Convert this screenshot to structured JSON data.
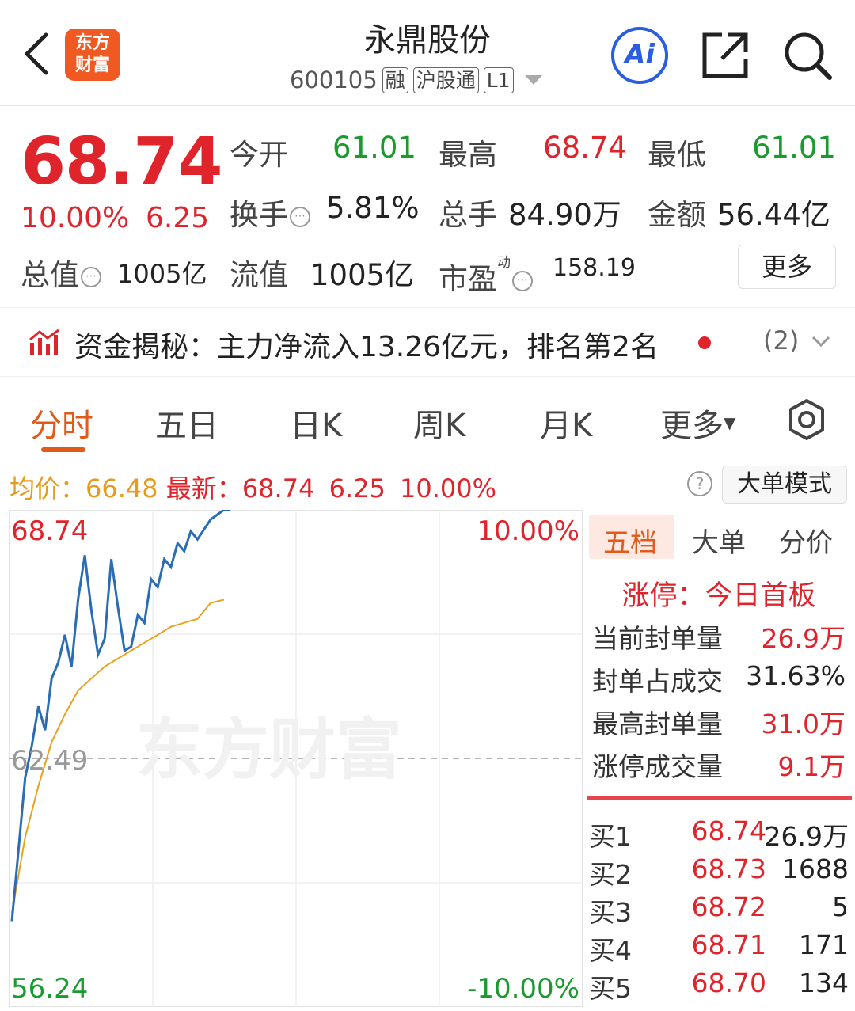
{
  "header": {
    "back_icon": "chevron-left-icon",
    "logo_line1": "东方",
    "logo_line2": "财富",
    "stock_name": "永鼎股份",
    "stock_code": "600105",
    "tags": [
      "融",
      "沪股通",
      "L1"
    ],
    "ai_label": "Ai",
    "share_icon": "share-icon",
    "search_icon": "search-icon"
  },
  "quote": {
    "price": "68.74",
    "change_pct": "10.00%",
    "change": "6.25",
    "open_label": "今开",
    "open_value": "61.01",
    "high_label": "最高",
    "high_value": "68.74",
    "low_label": "最低",
    "low_value": "61.01",
    "turnover_label": "换手",
    "turnover_value": "5.81%",
    "volume_label": "总手",
    "volume_value": "84.90万",
    "amount_label": "金额",
    "amount_value": "56.44亿",
    "mktcap_label": "总值",
    "mktcap_value": "1005亿",
    "float_label": "流值",
    "float_value": "1005亿",
    "pe_label": "市盈",
    "pe_sup": "动",
    "pe_value": "158.19",
    "more_label": "更多"
  },
  "fund_flow": {
    "text": "资金揭秘：主力净流入13.26亿元，排名第2名",
    "count": "(2)"
  },
  "tabs": {
    "items": [
      "分时",
      "五日",
      "日K",
      "周K",
      "月K",
      "更多"
    ],
    "active": "分时"
  },
  "summary": {
    "avg_label": "均价：",
    "avg_value": "66.48",
    "latest_label": "最新：",
    "latest_value": "68.74",
    "latest_change": "6.25",
    "latest_pct": "10.00%",
    "mode_button": "大单模式"
  },
  "chart": {
    "watermark": "东方财富",
    "y_top": "68.74",
    "y_mid": "62.49",
    "y_bottom": "56.24",
    "pct_top": "10.00%",
    "pct_bottom": "-10.00%",
    "colors": {
      "price": "#2a6db5",
      "avg": "#e8a21d",
      "up": "#e0242b",
      "down": "#1a9a2f"
    }
  },
  "chart_data": {
    "type": "line",
    "ylim": [
      56.24,
      68.74
    ],
    "xlim": [
      0,
      240
    ],
    "series": [
      {
        "values": [
          [
            0,
            58.4
          ],
          [
            0.5,
            60.2
          ],
          [
            1,
            62.0
          ],
          [
            1.5,
            62.8
          ],
          [
            2,
            63.8
          ],
          [
            2.5,
            63.2
          ],
          [
            3,
            64.5
          ],
          [
            3.5,
            64.9
          ],
          [
            4,
            65.6
          ],
          [
            4.5,
            64.8
          ],
          [
            5,
            66.5
          ],
          [
            5.5,
            67.6
          ],
          [
            6,
            66.2
          ],
          [
            6.5,
            65.1
          ],
          [
            7,
            65.5
          ],
          [
            7.5,
            67.5
          ],
          [
            8,
            66.3
          ],
          [
            8.5,
            65.2
          ],
          [
            9,
            65.3
          ],
          [
            9.5,
            66.1
          ],
          [
            10,
            65.9
          ],
          [
            10.5,
            67.0
          ],
          [
            11,
            66.8
          ],
          [
            11.5,
            67.5
          ],
          [
            12,
            67.3
          ],
          [
            12.5,
            67.9
          ],
          [
            13,
            67.7
          ],
          [
            13.5,
            68.2
          ],
          [
            14,
            68.0
          ],
          [
            15,
            68.5
          ],
          [
            16,
            68.74
          ],
          [
            16.5,
            68.74
          ]
        ]
      },
      {
        "values": [
          [
            0,
            58.6
          ],
          [
            1,
            60.5
          ],
          [
            2,
            61.8
          ],
          [
            3,
            62.9
          ],
          [
            4,
            63.6
          ],
          [
            5,
            64.2
          ],
          [
            6,
            64.5
          ],
          [
            7,
            64.8
          ],
          [
            8,
            65.0
          ],
          [
            9,
            65.2
          ],
          [
            10,
            65.4
          ],
          [
            11,
            65.6
          ],
          [
            12,
            65.8
          ],
          [
            13,
            65.9
          ],
          [
            14,
            66.0
          ],
          [
            15,
            66.4
          ],
          [
            16,
            66.48
          ]
        ]
      }
    ]
  },
  "order_book": {
    "tabs": [
      "五档",
      "大单",
      "分价"
    ],
    "active_tab": "五档",
    "limit_title": "涨停：今日首板",
    "stats": [
      {
        "label": "当前封单量",
        "value": "26.9万"
      },
      {
        "label": "封单占成交",
        "value": "31.63%"
      },
      {
        "label": "最高封单量",
        "value": "31.0万"
      },
      {
        "label": "涨停成交量",
        "value": "9.1万"
      }
    ],
    "bids": [
      {
        "label": "买1",
        "price": "68.74",
        "qty": "26.9万"
      },
      {
        "label": "买2",
        "price": "68.73",
        "qty": "1688"
      },
      {
        "label": "买3",
        "price": "68.72",
        "qty": "5"
      },
      {
        "label": "买4",
        "price": "68.71",
        "qty": "171"
      },
      {
        "label": "买5",
        "price": "68.70",
        "qty": "134"
      }
    ]
  }
}
